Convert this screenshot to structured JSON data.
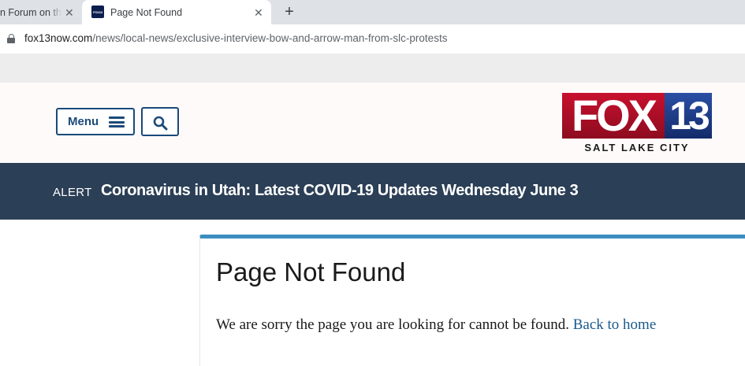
{
  "browser": {
    "tabs": [
      {
        "title": "n Forum on th",
        "active": false,
        "close": "✕"
      },
      {
        "title": "Page Not Found",
        "active": true,
        "close": "✕",
        "favicon_text": "FOX13"
      }
    ],
    "new_tab": "+",
    "url": {
      "domain": "fox13now.com",
      "path": "/news/local-news/exclusive-interview-bow-and-arrow-man-from-slc-protests"
    }
  },
  "header": {
    "menu_label": "Menu",
    "search_icon": "search-icon",
    "logo": {
      "fox": "FOX",
      "number": "13",
      "city": "SALT LAKE CITY"
    },
    "colors": {
      "brand_blue": "#1a4a7a",
      "logo_red": "#c8102e",
      "logo_blue": "#2a4fa5"
    }
  },
  "alert": {
    "label": "ALERT",
    "text": "Coronavirus in Utah: Latest COVID-19 Updates Wednesday June 3",
    "bg_color": "#2b3f56"
  },
  "main": {
    "title": "Page Not Found",
    "message": "We are sorry the page you are looking for cannot be found.",
    "link_text": "Back to home",
    "accent_color": "#3c8dc0"
  }
}
